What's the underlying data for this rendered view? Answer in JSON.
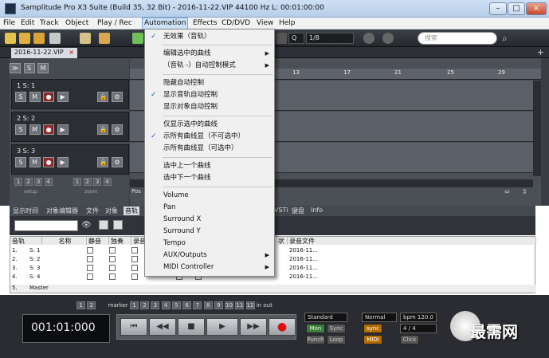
{
  "window": {
    "title": "Samplitude Pro X3 Suite (Build 35, 32 Bit)  -  2016-11-22.VIP   44100 Hz L: 00:01:00:00",
    "minimize": "–",
    "maximize": "□",
    "close": "×"
  },
  "menubar": {
    "items": [
      "File",
      "Edit",
      "Track",
      "Object",
      "Play / Rec",
      "Automation",
      "Effects",
      "CD/DVD",
      "View",
      "Help"
    ]
  },
  "toolbar": {
    "q_label": "Q",
    "quantize_value": "1/8",
    "search_placeholder": "搜索"
  },
  "project": {
    "tab_label": "2016-11-22.VIP",
    "tab_close": "×",
    "add": "+"
  },
  "tracks": {
    "header_btns": [
      "≫",
      "S",
      "M"
    ],
    "items": [
      {
        "name": "1   S: 1",
        "buttons": [
          "S",
          "M",
          "●",
          "▶"
        ]
      },
      {
        "name": "2   S: 2",
        "buttons": [
          "S",
          "M",
          "●",
          "▶"
        ]
      },
      {
        "name": "3   S: 3",
        "buttons": [
          "S",
          "M",
          "●",
          "▶"
        ]
      }
    ],
    "setup_label": "setup",
    "zoom_label": "zoom",
    "numbers": [
      "1",
      "2",
      "3",
      "4"
    ]
  },
  "ruler": {
    "ticks": [
      "13",
      "17",
      "21",
      "25",
      "29"
    ]
  },
  "position_label": "Pos",
  "manager_tabs": [
    "显示时间",
    "对象编辑器",
    "文件",
    "对象",
    "音轨",
    "VSTi",
    "键盘",
    "Info"
  ],
  "table": {
    "headers": [
      "音轨",
      "名称",
      "静音",
      "独奏",
      "录音",
      "状",
      "录音文件"
    ],
    "rows": [
      {
        "num": "1.",
        "name": "S: 1",
        "file": "2016-11..."
      },
      {
        "num": "2.",
        "name": "S: 2",
        "file": "2016-11..."
      },
      {
        "num": "3.",
        "name": "S: 3",
        "file": "2016-11..."
      },
      {
        "num": "4.",
        "name": "S: 4",
        "file": "2016-11..."
      },
      {
        "num": "5.",
        "name": "Master",
        "file": ""
      }
    ]
  },
  "transport": {
    "marker_label": "marker",
    "marker_nums": [
      "1",
      "2",
      "3",
      "4",
      "5",
      "6",
      "7",
      "8",
      "9",
      "10",
      "11",
      "12"
    ],
    "in_label": "in",
    "out_label": "out",
    "time": "001:01:000",
    "buttons": [
      "⏮",
      "◀◀",
      "■",
      "▶",
      "▶▶",
      "●"
    ],
    "mode": "Standard",
    "mon": "Mon",
    "sync": "Sync",
    "punch": "Punch",
    "loop": "Loop",
    "normal": "Normal",
    "bpm": "bpm 120.0",
    "signature": "4 / 4",
    "click": "Click",
    "midi": "MIDI",
    "watermark": "最需网"
  },
  "automation_menu": {
    "items": [
      {
        "label": "无效果（音轨）",
        "checked": true,
        "submenu": false
      },
      {
        "label": "编辑选中的曲线",
        "checked": false,
        "submenu": true
      },
      {
        "label": "（音轨 -）自动控制模式",
        "checked": false,
        "submenu": true
      },
      {
        "label": "隐藏自动控制",
        "checked": false,
        "submenu": false
      },
      {
        "label": "显示音轨自动控制",
        "checked": true,
        "submenu": false
      },
      {
        "label": "显示对象自动控制",
        "checked": false,
        "submenu": false
      },
      {
        "label": "仅显示选中的曲线",
        "checked": false,
        "submenu": false
      },
      {
        "label": "示所有曲线显（不可选中）",
        "checked": true,
        "submenu": false
      },
      {
        "label": "示所有曲线显（可选中）",
        "checked": false,
        "submenu": false
      },
      {
        "label": "选中上一个曲线",
        "checked": false,
        "submenu": false
      },
      {
        "label": "选中下一个曲线",
        "checked": false,
        "submenu": false
      },
      {
        "label": "Volume",
        "checked": false,
        "submenu": false
      },
      {
        "label": "Pan",
        "checked": false,
        "submenu": false
      },
      {
        "label": "Surround X",
        "checked": false,
        "submenu": false
      },
      {
        "label": "Surround Y",
        "checked": false,
        "submenu": false
      },
      {
        "label": "Tempo",
        "checked": false,
        "submenu": false
      },
      {
        "label": "AUX/Outputs",
        "checked": false,
        "submenu": true
      },
      {
        "label": "MIDI Controller",
        "checked": false,
        "submenu": true
      }
    ],
    "check_glyph": "✓",
    "arrow_glyph": "▶"
  }
}
